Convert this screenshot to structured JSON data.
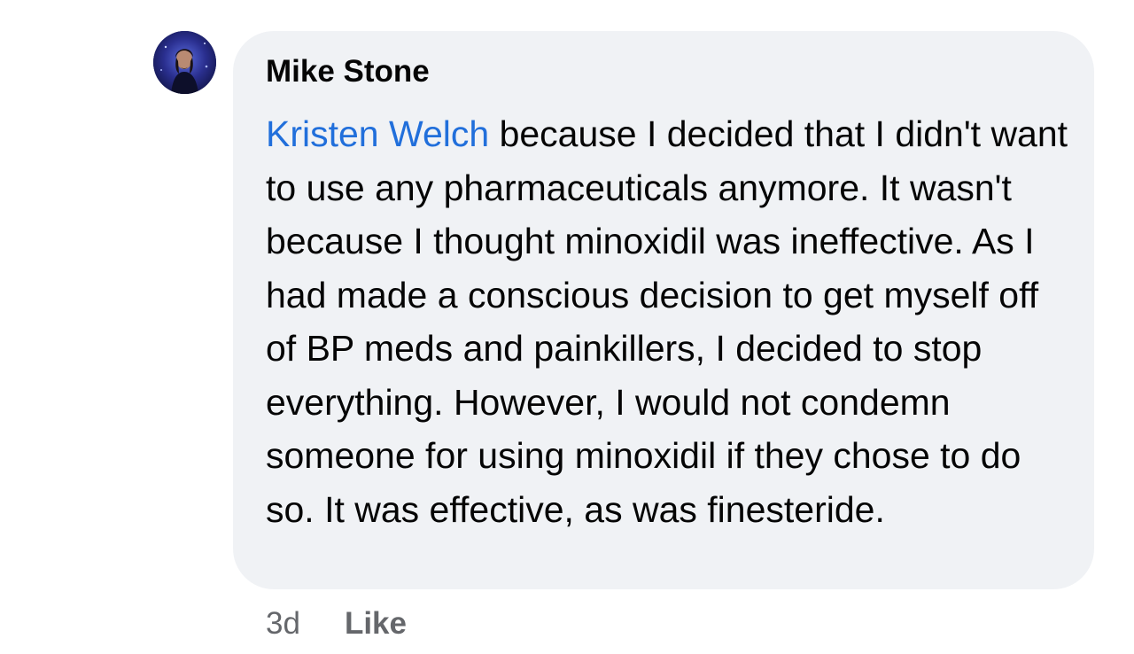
{
  "comment": {
    "author_name": "Mike Stone",
    "mention": "Kristen Welch",
    "text": " because I decided that I didn't want to use any pharmaceuticals anymore. It wasn't because I thought minoxidil was ineffective. As I had made a conscious decision to get myself off of BP meds and painkillers, I decided to stop everything. However, I would not condemn someone for using minoxidil if they chose to do so. It was effective, as was finesteride.",
    "avatar_icon": "profile-photo-icon"
  },
  "actions": {
    "timestamp": "3d",
    "like_label": "Like"
  },
  "colors": {
    "bubble_background": "#f0f2f5",
    "mention_link": "#216fdb",
    "secondary_text": "#65676b",
    "primary_text": "#050505"
  }
}
